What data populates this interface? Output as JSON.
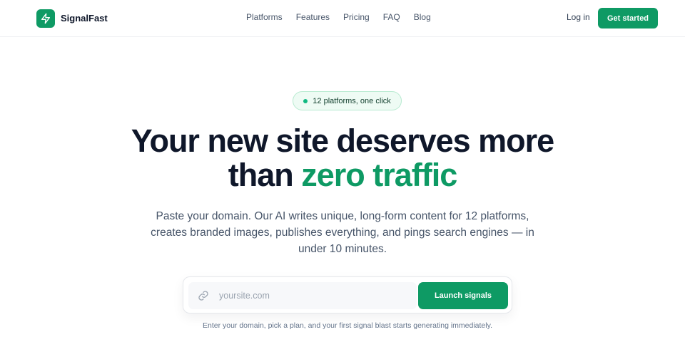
{
  "brand": {
    "name": "SignalFast",
    "icon": "lightning-bolt-icon",
    "color": "#0e9a64"
  },
  "nav": {
    "links": [
      "Platforms",
      "Features",
      "Pricing",
      "FAQ",
      "Blog"
    ],
    "login": "Log in",
    "cta": "Get started"
  },
  "hero": {
    "badge": "12 platforms, one click",
    "title_line1": "Your new site deserves more",
    "title_line2_prefix": "than ",
    "title_line2_accent": "zero traffic",
    "subtitle": "Paste your domain. Our AI writes unique, long-form content for 12 platforms, creates branded images, publishes everything, and pings search engines — in under 10 minutes."
  },
  "search": {
    "icon": "link-icon",
    "placeholder": "yoursite.com",
    "value": "",
    "button": "Launch signals",
    "helper": "Enter your domain, pick a plan, and your first signal blast starts generating immediately."
  },
  "colors": {
    "accent": "#0e9a64",
    "text": "#0f172a",
    "muted": "#475569",
    "badge_bg": "#eefbf4"
  }
}
